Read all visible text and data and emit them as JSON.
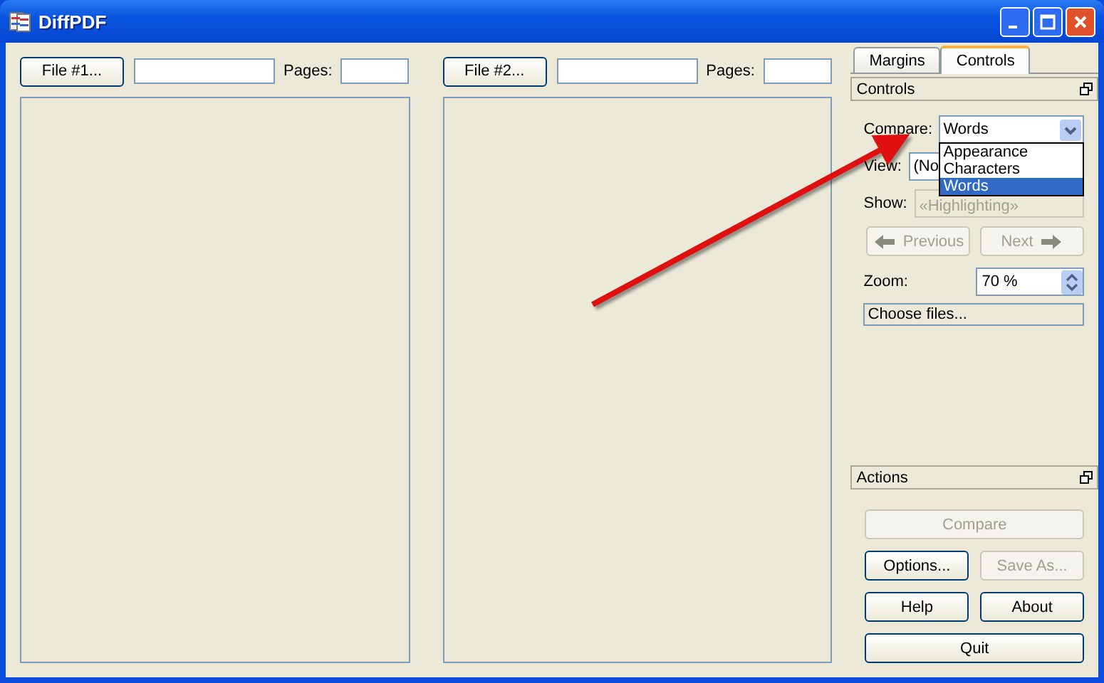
{
  "window": {
    "title": "DiffPDF"
  },
  "files": [
    {
      "button": "File #1...",
      "pages_label": "Pages:"
    },
    {
      "button": "File #2...",
      "pages_label": "Pages:"
    }
  ],
  "tabs": [
    {
      "label": "Margins",
      "selected": false
    },
    {
      "label": "Controls",
      "selected": true
    }
  ],
  "controls": {
    "title": "Controls",
    "compare": {
      "label": "Compare:",
      "value": "Words",
      "options": [
        {
          "label": "Appearance",
          "selected": false
        },
        {
          "label": "Characters",
          "selected": false
        },
        {
          "label": "Words",
          "selected": true
        }
      ]
    },
    "view": {
      "label": "View:",
      "value": "(No"
    },
    "show": {
      "label": "Show:",
      "value": "«Highlighting»",
      "disabled": true
    },
    "nav": [
      {
        "label": "Previous",
        "kind": "previous",
        "disabled": true
      },
      {
        "label": "Next",
        "kind": "next",
        "disabled": true
      }
    ],
    "zoom": {
      "label": "Zoom:",
      "value": "70 %"
    },
    "choose_files": "Choose files..."
  },
  "actions": {
    "title": "Actions",
    "buttons": [
      {
        "label": "Compare",
        "kind": "wide",
        "disabled": true
      },
      {
        "label": "Options...",
        "kind": "half",
        "disabled": false
      },
      {
        "label": "Save As...",
        "kind": "half",
        "disabled": true
      },
      {
        "label": "Help",
        "kind": "half",
        "disabled": false
      },
      {
        "label": "About",
        "kind": "half",
        "disabled": false
      },
      {
        "label": "Quit",
        "kind": "wide",
        "disabled": false
      }
    ]
  }
}
